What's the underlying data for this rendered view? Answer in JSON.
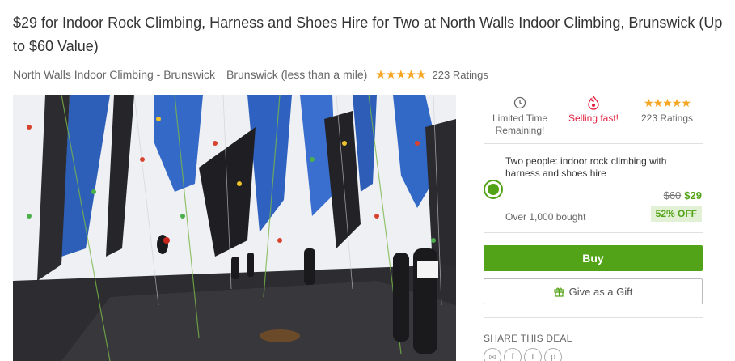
{
  "deal": {
    "title": "$29 for Indoor Rock Climbing, Harness and Shoes Hire for Two at North Walls Indoor Climbing, Brunswick (Up to $60 Value)",
    "merchant": "North Walls Indoor Climbing - Brunswick",
    "location": "Brunswick (less than a mile)",
    "stars": "★★★★★",
    "ratings": "223 Ratings"
  },
  "photo": {
    "icon": "climbing-gym-photo"
  },
  "badges": {
    "limited": "Limited Time Remaining!",
    "selling_fast": "Selling fast!",
    "stars": "★★★★★",
    "ratings": "223 Ratings"
  },
  "option": {
    "title": "Two people: indoor rock climbing with harness and shoes hire",
    "original_price": "$60",
    "price": "$29",
    "bought": "Over 1,000 bought",
    "discount": "52% OFF"
  },
  "actions": {
    "buy": "Buy",
    "gift": "Give as a Gift"
  },
  "share": {
    "label": "SHARE THIS DEAL",
    "icons": [
      "email-icon",
      "facebook-icon",
      "twitter-icon",
      "pinterest-icon"
    ],
    "glyphs": [
      "✉",
      "f",
      "t",
      "p"
    ]
  },
  "colors": {
    "accent_green": "#53a318",
    "alert_red": "#e0203d",
    "star_gold": "#f5a623"
  }
}
